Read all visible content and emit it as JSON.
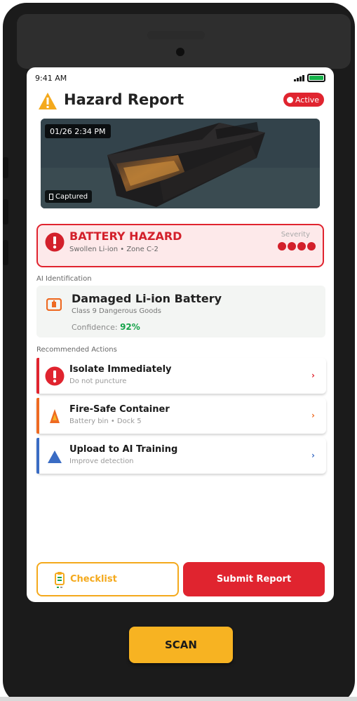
{
  "status_bar": {
    "time": "9:41 AM"
  },
  "header": {
    "title": "Hazard Report",
    "badge": "Active"
  },
  "photo": {
    "timestamp": "01/26 2:34 PM",
    "captured_label": "Captured"
  },
  "hazard": {
    "title": "BATTERY HAZARD",
    "subtitle": "Swollen Li-ion • Zone C-2",
    "severity_label": "Severity",
    "severity_level": 4
  },
  "ai": {
    "section_label": "AI Identification",
    "name": "Damaged Li-ion Battery",
    "class": "Class 9 Dangerous Goods",
    "confidence_label": "Confidence:",
    "confidence_value": "92%"
  },
  "actions": {
    "section_label": "Recommended Actions",
    "items": [
      {
        "title": "Isolate Immediately",
        "subtitle": "Do not puncture",
        "color": "#e0242f",
        "icon": "alert-circle-icon"
      },
      {
        "title": "Fire-Safe Container",
        "subtitle": "Battery bin • Dock 5",
        "color": "#ee6a22",
        "icon": "fire-cone-icon"
      },
      {
        "title": "Upload to AI Training",
        "subtitle": "Improve detection",
        "color": "#3a6cc4",
        "icon": "flask-icon"
      }
    ]
  },
  "footer": {
    "checklist_label": "Checklist",
    "submit_label": "Submit Report"
  },
  "device": {
    "scan_label": "SCAN"
  },
  "colors": {
    "danger": "#e0242f",
    "warning": "#f4a91c",
    "success": "#16a34a",
    "info": "#3a6cc4",
    "orange": "#ee6a22"
  }
}
